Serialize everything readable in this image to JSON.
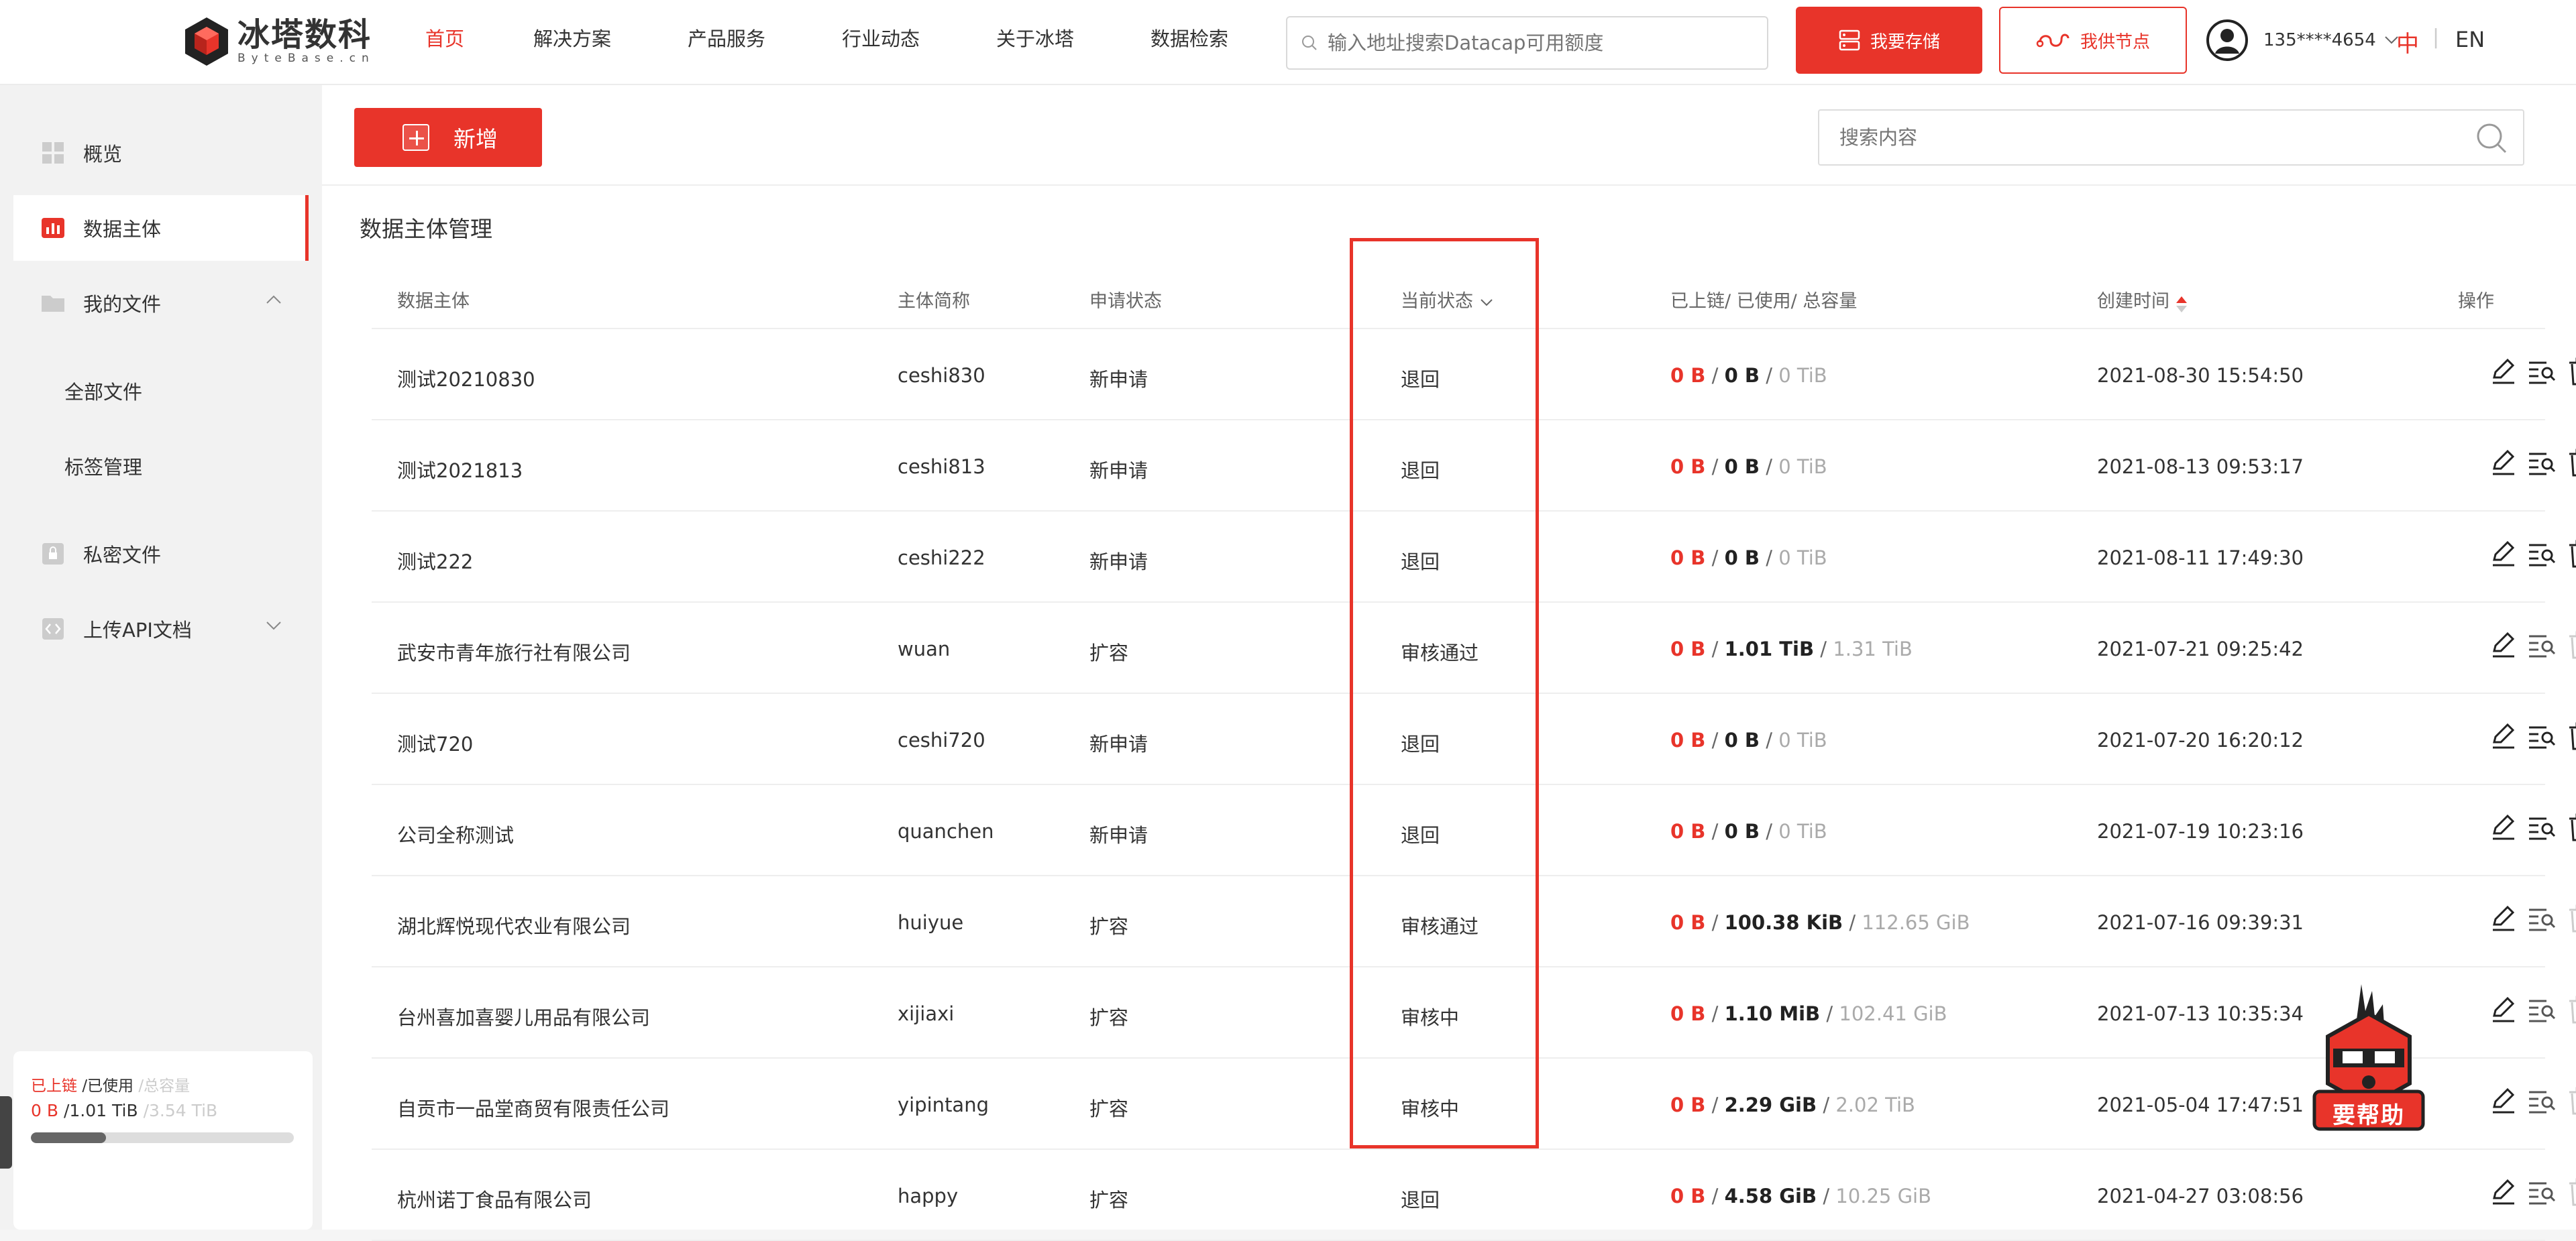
{
  "brand": {
    "name_cn": "冰塔数科",
    "name_en": "ByteBase.cn"
  },
  "nav": {
    "items": [
      "首页",
      "解决方案",
      "产品服务",
      "行业动态",
      "关于冰塔",
      "数据检索"
    ],
    "active_index": 0
  },
  "top_search": {
    "placeholder": "输入地址搜索Datacap可用额度"
  },
  "header_buttons": {
    "store": "我要存储",
    "node": "我供节点"
  },
  "user": {
    "phone": "135****4654"
  },
  "lang": {
    "zh": "中",
    "sep": "|",
    "en": "EN"
  },
  "sidebar": {
    "overview": "概览",
    "data_subject": "数据主体",
    "my_files": "我的文件",
    "all_files": "全部文件",
    "tag_mgmt": "标签管理",
    "private_files": "私密文件",
    "upload_api": "上传API文档"
  },
  "quota": {
    "label_onchain": "已上链",
    "label_used": "/已使用",
    "label_total": "/总容量",
    "onchain": "0 B",
    "used": "/1.01 TiB",
    "total": "/3.54 TiB",
    "used_fraction": 0.285
  },
  "toolbar": {
    "add_label": "新增",
    "search_placeholder": "搜索内容"
  },
  "page_title": "数据主体管理",
  "table": {
    "headers": {
      "subject": "数据主体",
      "short_name": "主体简称",
      "apply_status": "申请状态",
      "current_status": "当前状态",
      "capacity": "已上链/ 已使用/ 总容量",
      "created": "创建时间",
      "ops": "操作"
    },
    "rows": [
      {
        "subject": "测试20210830",
        "short": "ceshi830",
        "apply": "新申请",
        "status": "退回",
        "onchain": "0 B",
        "used": "0 B",
        "total": "0 TiB",
        "created": "2021-08-30 15:54:50",
        "deletable": true
      },
      {
        "subject": "测试2021813",
        "short": "ceshi813",
        "apply": "新申请",
        "status": "退回",
        "onchain": "0 B",
        "used": "0 B",
        "total": "0 TiB",
        "created": "2021-08-13 09:53:17",
        "deletable": true
      },
      {
        "subject": "测试222",
        "short": "ceshi222",
        "apply": "新申请",
        "status": "退回",
        "onchain": "0 B",
        "used": "0 B",
        "total": "0 TiB",
        "created": "2021-08-11 17:49:30",
        "deletable": true
      },
      {
        "subject": "武安市青年旅行社有限公司",
        "short": "wuan",
        "apply": "扩容",
        "status": "审核通过",
        "onchain": "0 B",
        "used": "1.01 TiB",
        "total": "1.31 TiB",
        "created": "2021-07-21 09:25:42",
        "deletable": false
      },
      {
        "subject": "测试720",
        "short": "ceshi720",
        "apply": "新申请",
        "status": "退回",
        "onchain": "0 B",
        "used": "0 B",
        "total": "0 TiB",
        "created": "2021-07-20 16:20:12",
        "deletable": true
      },
      {
        "subject": "公司全称测试",
        "short": "quanchen",
        "apply": "新申请",
        "status": "退回",
        "onchain": "0 B",
        "used": "0 B",
        "total": "0 TiB",
        "created": "2021-07-19 10:23:16",
        "deletable": true
      },
      {
        "subject": "湖北辉悦现代农业有限公司",
        "short": "huiyue",
        "apply": "扩容",
        "status": "审核通过",
        "onchain": "0 B",
        "used": "100.38 KiB",
        "total": "112.65 GiB",
        "created": "2021-07-16 09:39:31",
        "deletable": false
      },
      {
        "subject": "台州喜加喜婴儿用品有限公司",
        "short": "xijiaxi",
        "apply": "扩容",
        "status": "审核中",
        "onchain": "0 B",
        "used": "1.10 MiB",
        "total": "102.41 GiB",
        "created": "2021-07-13 10:35:34",
        "deletable": false
      },
      {
        "subject": "自贡市一品堂商贸有限责任公司",
        "short": "yipintang",
        "apply": "扩容",
        "status": "审核中",
        "onchain": "0 B",
        "used": "2.29 GiB",
        "total": "2.02 TiB",
        "created": "2021-05-04 17:47:51",
        "deletable": false
      },
      {
        "subject": "杭州诺丁食品有限公司",
        "short": "happy",
        "apply": "扩容",
        "status": "退回",
        "onchain": "0 B",
        "used": "4.58 GiB",
        "total": "10.25 GiB",
        "created": "2021-04-27 03:08:56",
        "deletable": false
      }
    ]
  },
  "helper": {
    "label": "要帮助"
  },
  "colors": {
    "accent": "#e8342a",
    "sidebar_bg": "#f2f2f2",
    "muted": "#aaaaaa"
  }
}
